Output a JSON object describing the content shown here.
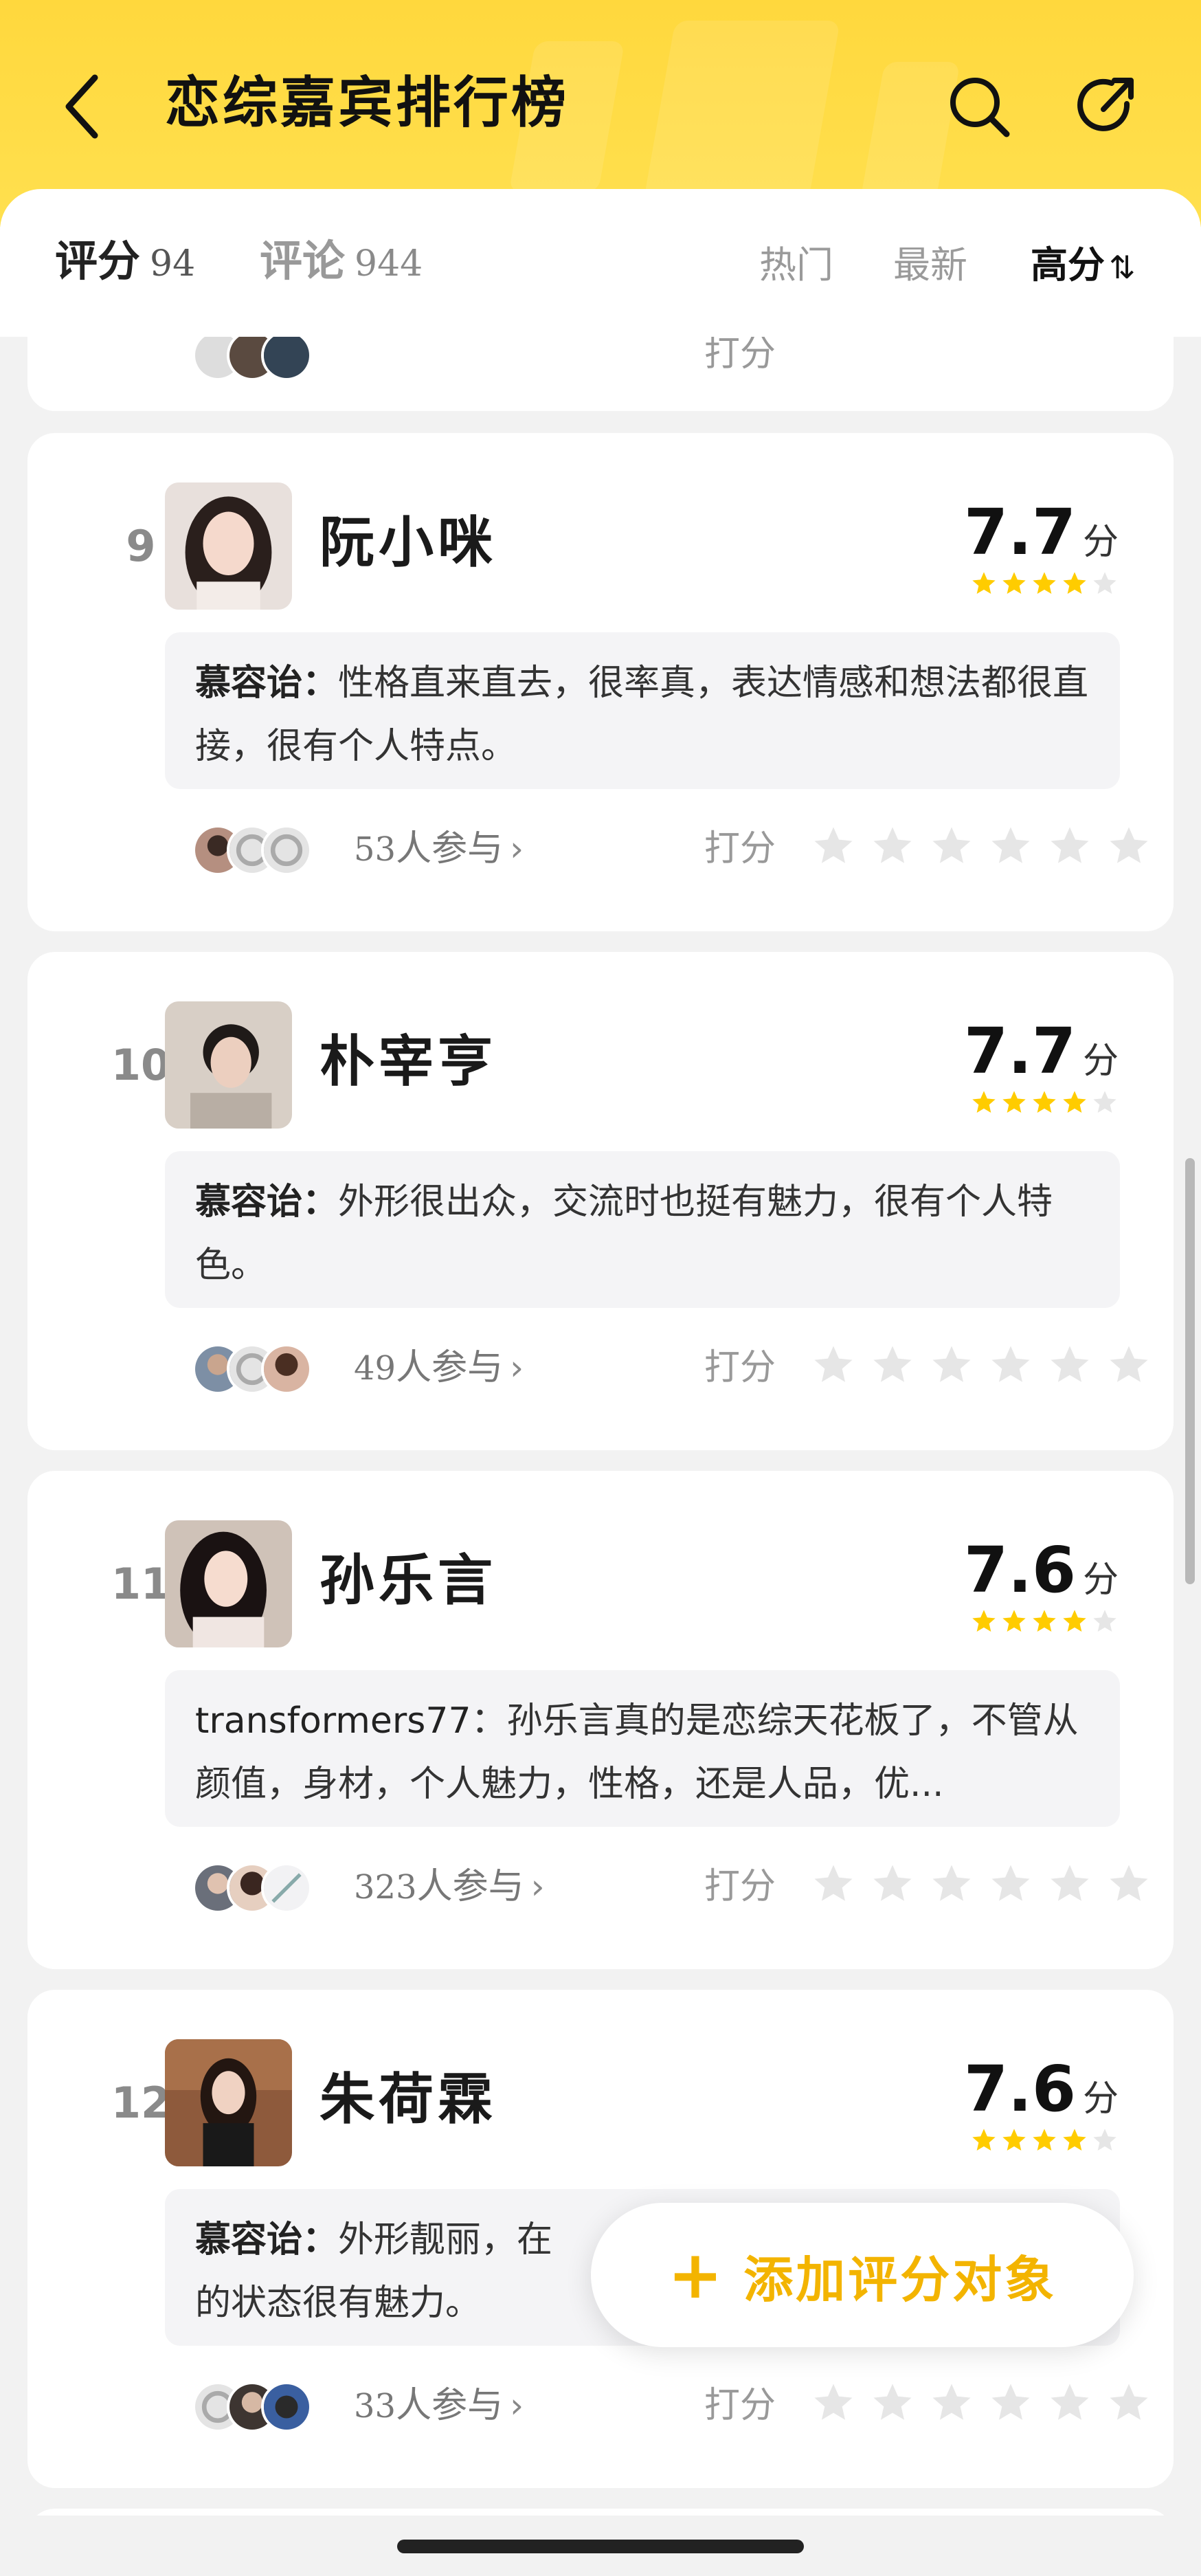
{
  "header": {
    "title": "恋综嘉宾排行榜",
    "back_icon": "chevron-left-icon",
    "search_icon": "search-icon",
    "share_icon": "share-icon",
    "color": "#FFDA40"
  },
  "tabs": {
    "score_label": "评分",
    "score_count": "94",
    "comment_label": "评论",
    "comment_count": "944",
    "sort_hot": "热门",
    "sort_new": "最新",
    "sort_high": "高分",
    "sort_icon": "⇅"
  },
  "partial_card": {
    "rate_label": "打分"
  },
  "entries": [
    {
      "rank": "9",
      "name": "阮小咪",
      "score": "7.7",
      "unit": "分",
      "stars": 4,
      "comment_author": "慕容诒",
      "comment_sep": "：",
      "comment_text": "性格直来直去，很率真，表达情感和想法都很直接，很有个人特点。",
      "participants_num": "53",
      "participants_suffix": "人参与",
      "rate_label": "打分"
    },
    {
      "rank": "10",
      "name": "朴宰亨",
      "score": "7.7",
      "unit": "分",
      "stars": 4,
      "comment_author": "慕容诒",
      "comment_sep": "：",
      "comment_text": "外形很出众，交流时也挺有魅力，很有个人特色。",
      "participants_num": "49",
      "participants_suffix": "人参与",
      "rate_label": "打分"
    },
    {
      "rank": "11",
      "name": "孙乐言",
      "score": "7.6",
      "unit": "分",
      "stars": 4,
      "comment_author": "transformers77",
      "comment_sep": "：",
      "comment_text": "孙乐言真的是恋综天花板了，不管从颜值，身材，个人魅力，性格，还是人品，优...",
      "participants_num": "323",
      "participants_suffix": "人参与",
      "rate_label": "打分"
    },
    {
      "rank": "12",
      "name": "朱荷霖",
      "score": "7.6",
      "unit": "分",
      "stars": 4,
      "comment_author": "慕容诒",
      "comment_sep": "：",
      "comment_text": "外形靓丽，在",
      "comment_text_line2": "的状态很有魅力。",
      "participants_num": "33",
      "participants_suffix": "人参与",
      "rate_label": "打分"
    }
  ],
  "fab": {
    "plus": "+",
    "label": "添加评分对象"
  },
  "colors": {
    "accent": "#F3B400",
    "star_filled": "#FFCC00",
    "star_empty": "#E6E6E6"
  }
}
